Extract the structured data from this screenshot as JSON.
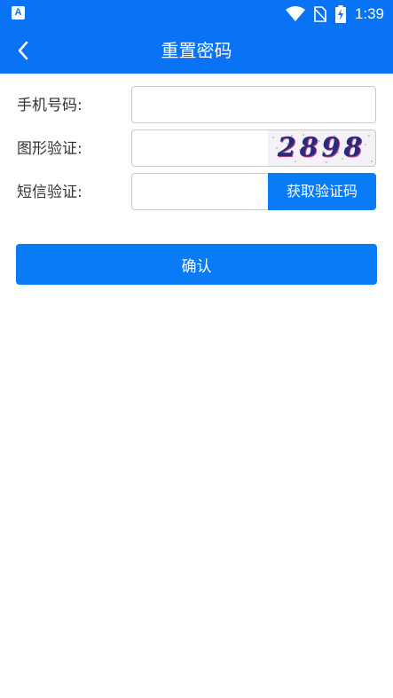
{
  "status_bar": {
    "app_icon": "A",
    "icons": [
      "wifi-icon",
      "no-sim-icon",
      "battery-charging-icon"
    ],
    "time": "1:39"
  },
  "app_bar": {
    "back_icon": "chevron-left-icon",
    "title": "重置密码"
  },
  "form": {
    "phone": {
      "label": "手机号码:",
      "value": "",
      "placeholder": ""
    },
    "captcha": {
      "label": "图形验证:",
      "value": "",
      "placeholder": "",
      "image_text": "2898"
    },
    "sms": {
      "label": "短信验证:",
      "value": "",
      "placeholder": "",
      "button": "获取验证码"
    }
  },
  "confirm_button": "确认",
  "colors": {
    "primary": "#0a73f5",
    "button": "#0a7bf7"
  }
}
